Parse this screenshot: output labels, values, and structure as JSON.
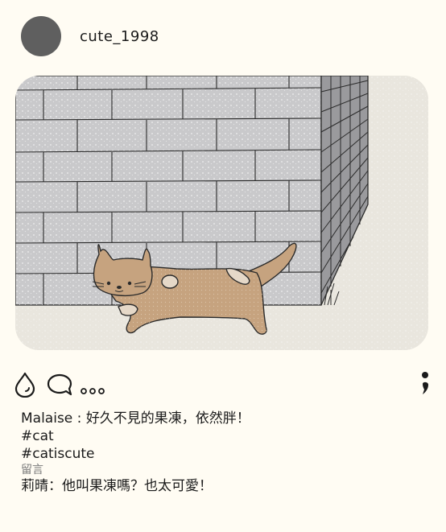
{
  "post": {
    "username": "cute_1998",
    "caption_user": "Malaise",
    "caption_sep": " : ",
    "caption_text": "好久不見的果凍，依然胖！",
    "tags": [
      "#cat",
      "#catiscute"
    ],
    "comments_label": "留言",
    "comment": "莉晴：他叫果凍嗎？也太可愛！"
  },
  "icons": {
    "like": "drop-like-icon",
    "comment": "speech-bubble-icon",
    "more": "ellipsis-icon",
    "save": "semicolon-bookmark-icon"
  },
  "colors": {
    "background": "#fffcf3",
    "avatar": "#5f5f5f",
    "brick": "#c9c9cb",
    "cat": "#c6a37f"
  }
}
